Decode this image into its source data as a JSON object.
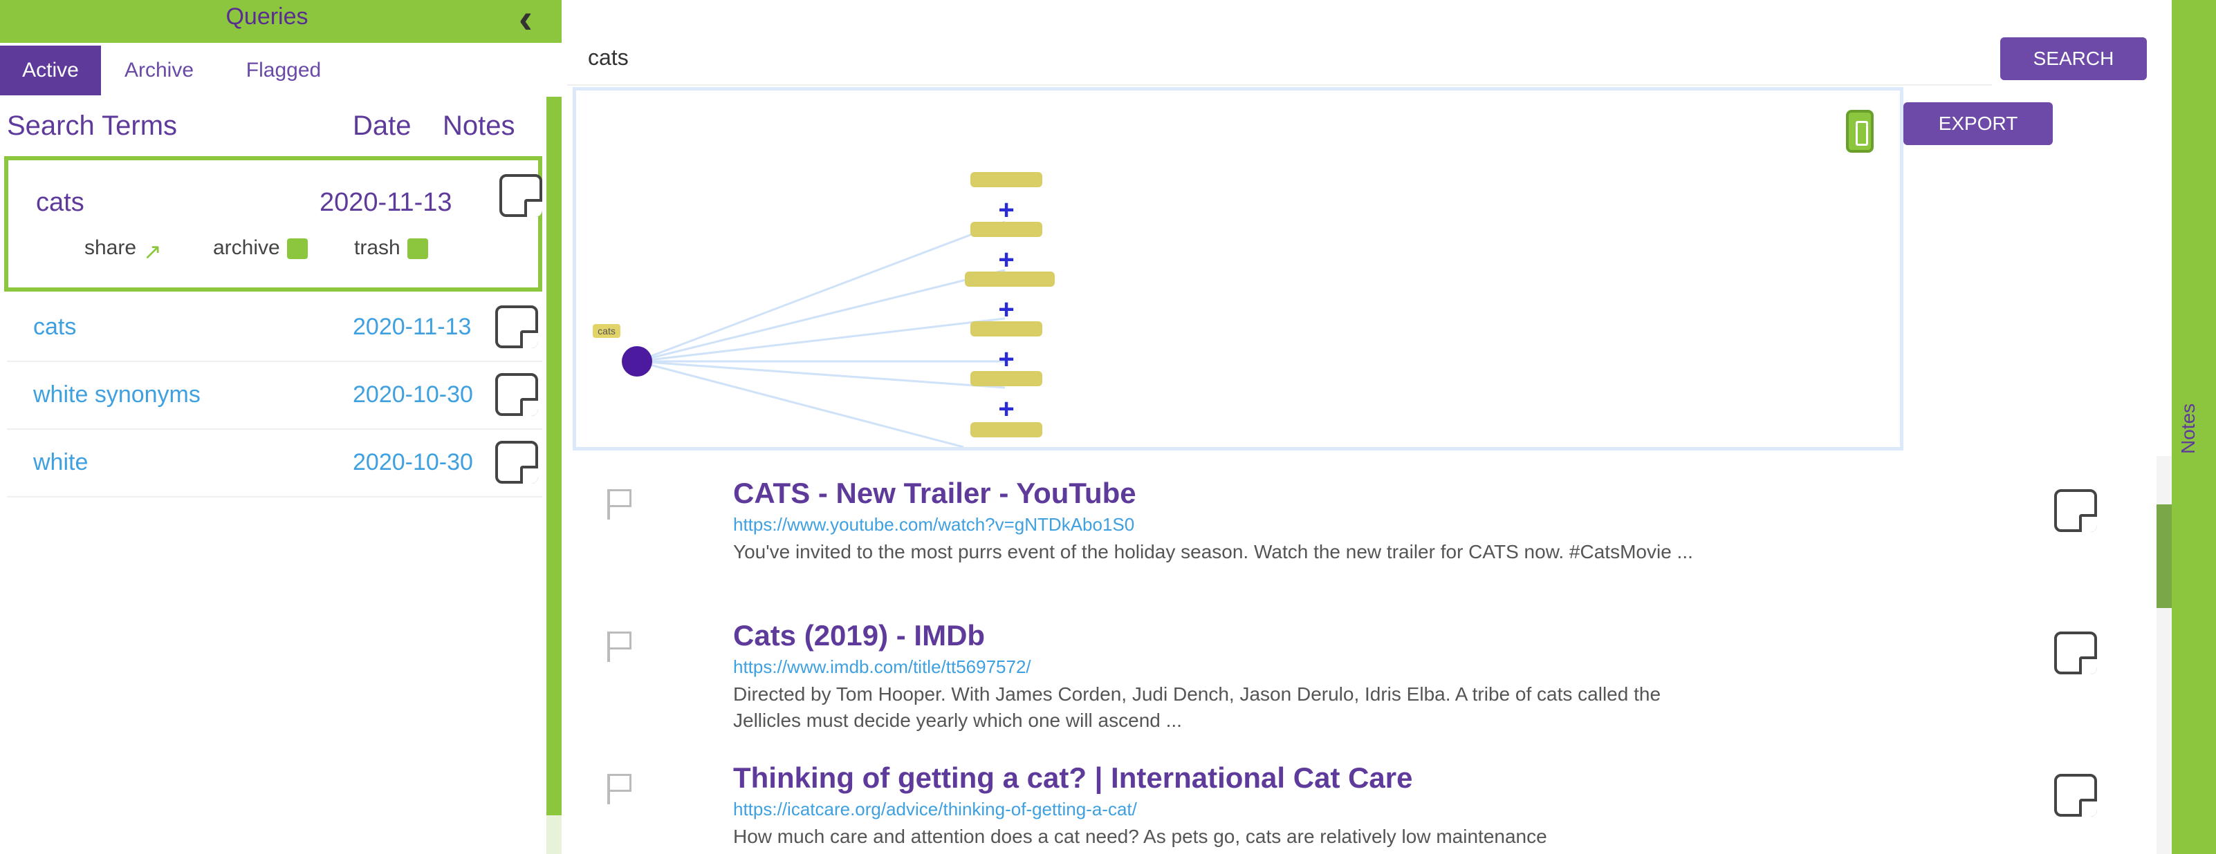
{
  "left_panel": {
    "title": "Queries",
    "collapse_glyph": "‹",
    "tabs": [
      {
        "label": "Active",
        "active": true
      },
      {
        "label": "Archive",
        "active": false
      },
      {
        "label": "Flagged",
        "active": false
      }
    ],
    "columns": {
      "search_terms": "Search Terms",
      "date": "Date",
      "notes": "Notes"
    },
    "selected_query": {
      "term": "cats",
      "date": "2020-11-13",
      "actions": {
        "share": "share",
        "share_icon": "↗",
        "archive": "archive",
        "trash": "trash"
      }
    },
    "queries": [
      {
        "term": "cats",
        "date": "2020-11-13"
      },
      {
        "term": "white synonyms",
        "date": "2020-10-30"
      },
      {
        "term": "white",
        "date": "2020-10-30"
      }
    ]
  },
  "search": {
    "value": "cats",
    "button_label": "SEARCH"
  },
  "graph": {
    "root_label": "cats",
    "export_label": "EXPORT"
  },
  "results": [
    {
      "title": "CATS - New Trailer - YouTube",
      "url": "https://www.youtube.com/watch?v=gNTDkAbo1S0",
      "snippet": "You've invited to the most purrs event of the holiday season. Watch the new trailer for CATS now. #CatsMovie ..."
    },
    {
      "title": "Cats (2019) - IMDb",
      "url": "https://www.imdb.com/title/tt5697572/",
      "snippet": "Directed by Tom Hooper. With James Corden, Judi Dench, Jason Derulo, Idris Elba. A tribe of cats called the Jellicles must decide yearly which one will ascend ..."
    },
    {
      "title": "Thinking of getting a cat? | International Cat Care",
      "url": "https://icatcare.org/advice/thinking-of-getting-a-cat/",
      "snippet": "How much care and attention does a cat need? As pets go, cats are relatively low maintenance"
    }
  ],
  "right_rail": {
    "label": "Notes"
  },
  "colors": {
    "brand_green": "#8cc63f",
    "brand_purple": "#5e3a9b",
    "link_blue": "#3fa0e0"
  }
}
